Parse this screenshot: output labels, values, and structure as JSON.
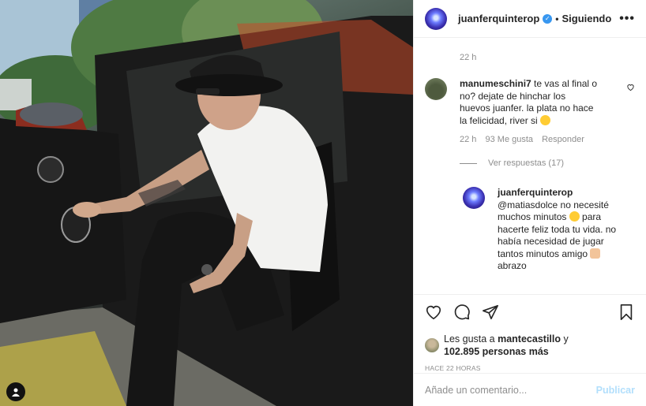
{
  "post": {
    "author": "juanferquinterop",
    "follow_status": "Siguiendo",
    "more_glyph": "•••",
    "verified_glyph": "✓"
  },
  "comments_area": {
    "caption_time": "22 h",
    "comment": {
      "user": "manumeschini7",
      "text": "te vas al final o no? dejate de hinchar los huevos juanfer. la plata no hace la felicidad, river si",
      "time": "22 h",
      "likes": "93 Me gusta",
      "reply_label": "Responder"
    },
    "view_replies": "Ver respuestas (17)",
    "reply": {
      "user": "juanferquinterop",
      "mention": "@matiasdolce",
      "text_a": " no necesité muchos minutos",
      "text_b": " para hacerte feliz toda tu vida. no había necesidad de jugar tantos minutos amigo",
      "text_c": " abrazo"
    }
  },
  "likes": {
    "prefix": "Les gusta a ",
    "user": "mantecastillo",
    "suffix": " y",
    "count": "102.895 personas más"
  },
  "posted_ago": "HACE 22 HORAS",
  "comment_box": {
    "placeholder": "Añade un comentario...",
    "publish": "Publicar"
  },
  "icons": [
    "heart-icon",
    "comment-icon",
    "share-icon",
    "bookmark-icon",
    "user-tag-icon"
  ],
  "colors": {
    "verified": "#3897f0",
    "publish_disabled": "#b2dffc",
    "muted": "#8e8e8e"
  }
}
